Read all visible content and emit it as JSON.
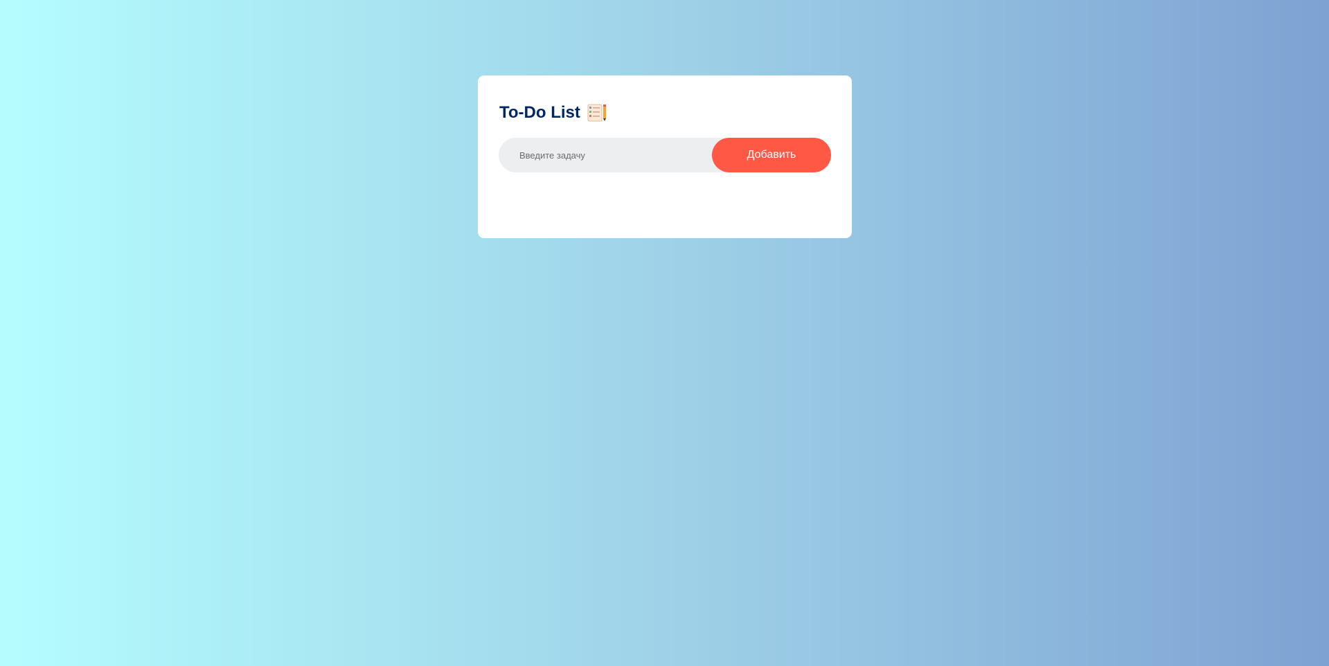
{
  "app": {
    "title": "To-Do List",
    "title_icon": "notepad-checklist-icon"
  },
  "form": {
    "input_placeholder": "Введите задачу",
    "input_value": "",
    "add_button_label": "Добавить"
  },
  "tasks": [],
  "colors": {
    "title": "#002765",
    "button": "#ff5945",
    "input_background": "#edeef0",
    "background_start": "#b4fdfe",
    "background_end": "#7ea2d3"
  }
}
